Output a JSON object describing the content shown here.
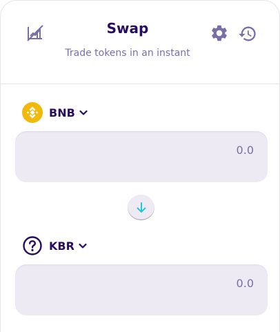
{
  "header": {
    "title": "Swap",
    "subtitle": "Trade tokens in an instant"
  },
  "icons": {
    "chart_toggle": "chart-disabled-icon",
    "settings": "gear-icon",
    "history": "history-icon",
    "switch": "arrow-down-icon"
  },
  "from_token": {
    "symbol": "BNB",
    "icon": "bnb-logo-icon",
    "amount_placeholder": "0.0"
  },
  "to_token": {
    "symbol": "KBR",
    "icon": "unknown-token-icon",
    "amount_placeholder": "0.0"
  },
  "colors": {
    "primary_text": "#280d5f",
    "secondary_text": "#7a6eaa",
    "input_bg": "#eeeaf4",
    "accent": "#1fc7d4",
    "bnb_yellow": "#f0b90b"
  }
}
